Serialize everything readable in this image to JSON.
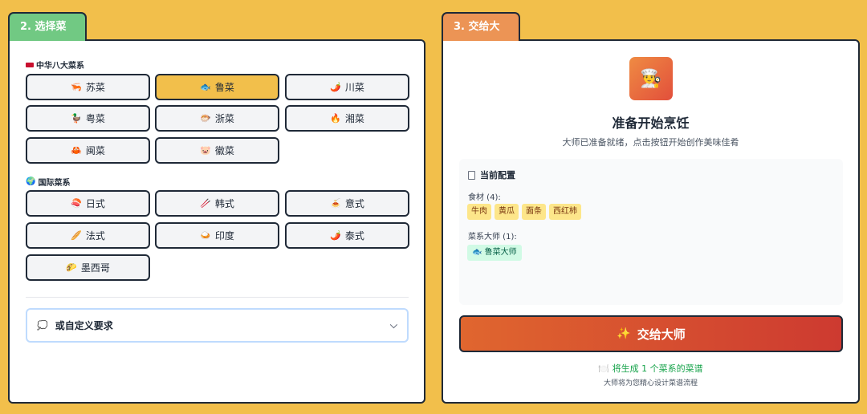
{
  "left_panel": {
    "tab_label": "2. 选择菜系",
    "chinese_section": {
      "label": "中华八大菜系",
      "items": [
        {
          "label": "苏菜",
          "emoji": "🦐",
          "selected": false
        },
        {
          "label": "鲁菜",
          "emoji": "🐟",
          "selected": true
        },
        {
          "label": "川菜",
          "emoji": "🌶️",
          "selected": false
        },
        {
          "label": "粤菜",
          "emoji": "🦆",
          "selected": false
        },
        {
          "label": "浙菜",
          "emoji": "🐡",
          "selected": false
        },
        {
          "label": "湘菜",
          "emoji": "🔥",
          "selected": false
        },
        {
          "label": "闽菜",
          "emoji": "🦀",
          "selected": false
        },
        {
          "label": "徽菜",
          "emoji": "🐷",
          "selected": false
        }
      ]
    },
    "intl_section": {
      "label": "国际菜系",
      "items": [
        {
          "label": "日式",
          "emoji": "🍣"
        },
        {
          "label": "韩式",
          "emoji": "🥢"
        },
        {
          "label": "意式",
          "emoji": "🍝"
        },
        {
          "label": "法式",
          "emoji": "🥖"
        },
        {
          "label": "印度",
          "emoji": "🍛"
        },
        {
          "label": "泰式",
          "emoji": "🌶️"
        },
        {
          "label": "墨西哥",
          "emoji": "🌮"
        }
      ]
    },
    "custom": {
      "label": "或自定义要求",
      "icon": "chat-bubble-icon"
    }
  },
  "right_panel": {
    "tab_label": "3. 交给大师",
    "chef_emoji": "👨‍🍳",
    "title": "准备开始烹饪",
    "subtitle": "大师已准备就绪，点击按钮开始创作美味佳肴",
    "config": {
      "title": "当前配置",
      "ingredients_label": "食材 (4):",
      "ingredients": [
        "牛肉",
        "黄瓜",
        "面条",
        "西红柿"
      ],
      "masters_label": "菜系大师 (1):",
      "masters": [
        {
          "emoji": "🐟",
          "label": "鲁菜大师"
        }
      ]
    },
    "button_label": "交给大师",
    "button_sparkle": "✨",
    "note_plate": "🍽️",
    "note": "将生成 1 个菜系的菜谱",
    "sub_note": "大师将为您精心设计菜谱流程"
  },
  "colors": {
    "background": "#f2bf4b",
    "tab_green": "#71c983",
    "tab_orange": "#ec9455",
    "selected": "#f2bf4b",
    "button_start": "#e0662f",
    "button_end": "#cd3a30"
  }
}
